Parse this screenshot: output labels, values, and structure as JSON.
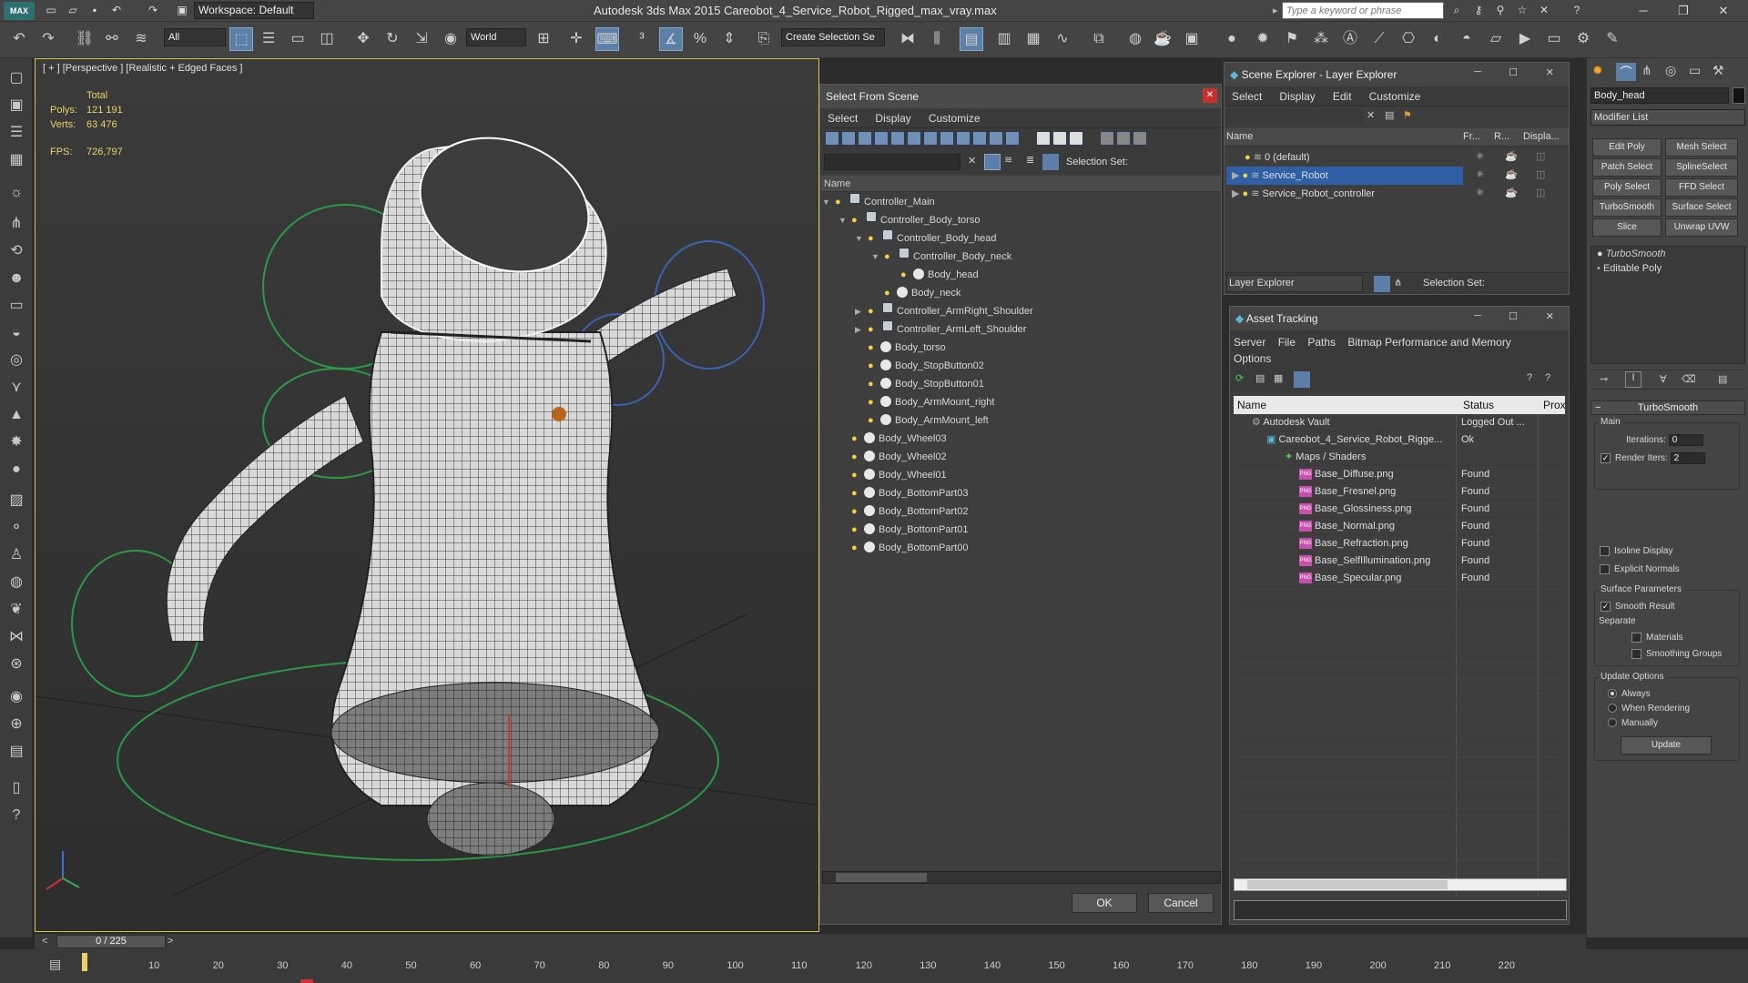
{
  "titlebar": {
    "logo": "MAX",
    "workspace_label": "Workspace: Default",
    "app_title": "Autodesk 3ds Max  2015     Careobot_4_Service_Robot_Rigged_max_vray.max",
    "search_placeholder": "Type a keyword or phrase"
  },
  "toolbar": {
    "selection_filter": "All",
    "reference_coord": "World",
    "selection_set_placeholder": "Create Selection Se"
  },
  "viewport": {
    "label": "[ + ] [Perspective ] [Realistic + Edged Faces ]",
    "stats": {
      "total_label": "Total",
      "polys_label": "Polys:",
      "polys_value": "121 191",
      "verts_label": "Verts:",
      "verts_value": "63 476",
      "fps_label": "FPS:",
      "fps_value": "726,797"
    }
  },
  "select_from_scene": {
    "title": "Select From Scene",
    "menu": [
      "Select",
      "Display",
      "Customize"
    ],
    "selection_set_label": "Selection Set:",
    "column_name": "Name",
    "items": [
      {
        "label": "Controller_Main"
      },
      {
        "label": "Controller_Body_torso"
      },
      {
        "label": "Controller_Body_head"
      },
      {
        "label": "Controller_Body_neck"
      },
      {
        "label": "Body_head"
      },
      {
        "label": "Body_neck"
      },
      {
        "label": "Controller_ArmRight_Shoulder"
      },
      {
        "label": "Controller_ArmLeft_Shoulder"
      },
      {
        "label": "Body_torso"
      },
      {
        "label": "Body_StopButton02"
      },
      {
        "label": "Body_StopButton01"
      },
      {
        "label": "Body_ArmMount_right"
      },
      {
        "label": "Body_ArmMount_left"
      },
      {
        "label": "Body_Wheel03"
      },
      {
        "label": "Body_Wheel02"
      },
      {
        "label": "Body_Wheel01"
      },
      {
        "label": "Body_BottomPart03"
      },
      {
        "label": "Body_BottomPart02"
      },
      {
        "label": "Body_BottomPart01"
      },
      {
        "label": "Body_BottomPart00"
      }
    ],
    "ok_label": "OK",
    "cancel_label": "Cancel"
  },
  "scene_explorer": {
    "title": "Scene Explorer - Layer Explorer",
    "menu": [
      "Select",
      "Display",
      "Edit",
      "Customize"
    ],
    "columns": [
      "Name",
      "Fr...",
      "R...",
      "Displa..."
    ],
    "layers": [
      {
        "label": "0 (default)"
      },
      {
        "label": "Service_Robot"
      },
      {
        "label": "Service_Robot_controller"
      }
    ],
    "footer_dropdown": "Layer Explorer",
    "selection_set_label": "Selection Set:"
  },
  "asset_tracking": {
    "title": "Asset Tracking",
    "menu": [
      "Server",
      "File",
      "Paths",
      "Bitmap Performance and Memory",
      "Options"
    ],
    "columns": [
      "Name",
      "Status",
      "Prox"
    ],
    "rows": [
      {
        "name": "Autodesk Vault",
        "status": "Logged Out ..."
      },
      {
        "name": "Careobot_4_Service_Robot_Rigge...",
        "status": "Ok"
      },
      {
        "name": "Maps / Shaders",
        "status": ""
      },
      {
        "name": "Base_Diffuse.png",
        "status": "Found"
      },
      {
        "name": "Base_Fresnel.png",
        "status": "Found"
      },
      {
        "name": "Base_Glossiness.png",
        "status": "Found"
      },
      {
        "name": "Base_Normal.png",
        "status": "Found"
      },
      {
        "name": "Base_Refraction.png",
        "status": "Found"
      },
      {
        "name": "Base_SelfIllumination.png",
        "status": "Found"
      },
      {
        "name": "Base_Specular.png",
        "status": "Found"
      }
    ],
    "png_badge": "PNG"
  },
  "command_panel": {
    "object_name": "Body_head",
    "modifier_list": "Modifier List",
    "modifier_buttons": [
      "Edit Poly",
      "Mesh Select",
      "Patch Select",
      "SplineSelect",
      "Poly Select",
      "FFD Select",
      "TurboSmooth",
      "Surface Select",
      "Slice",
      "Unwrap UVW"
    ],
    "stack": [
      "TurboSmooth",
      "Editable Poly"
    ],
    "rollout_title": "TurboSmooth",
    "main_label": "Main",
    "iterations_label": "Iterations:",
    "iterations_value": "0",
    "render_iters_label": "Render Iters:",
    "render_iters_value": "2",
    "isoline_label": "Isoline Display",
    "explicit_normals_label": "Explicit Normals",
    "surface_params_label": "Surface Parameters",
    "smooth_result_label": "Smooth Result",
    "separate_label": "Separate",
    "materials_label": "Materials",
    "smoothing_groups_label": "Smoothing Groups",
    "update_options_label": "Update Options",
    "always_label": "Always",
    "when_rendering_label": "When Rendering",
    "manually_label": "Manually",
    "update_label": "Update"
  },
  "timeline": {
    "frame_counter": "0 / 225",
    "ticks": [
      "10",
      "20",
      "30",
      "40",
      "50",
      "60",
      "70",
      "80",
      "90",
      "100",
      "110",
      "120",
      "130",
      "140",
      "150",
      "160",
      "170",
      "180",
      "190",
      "200",
      "210",
      "220"
    ]
  }
}
